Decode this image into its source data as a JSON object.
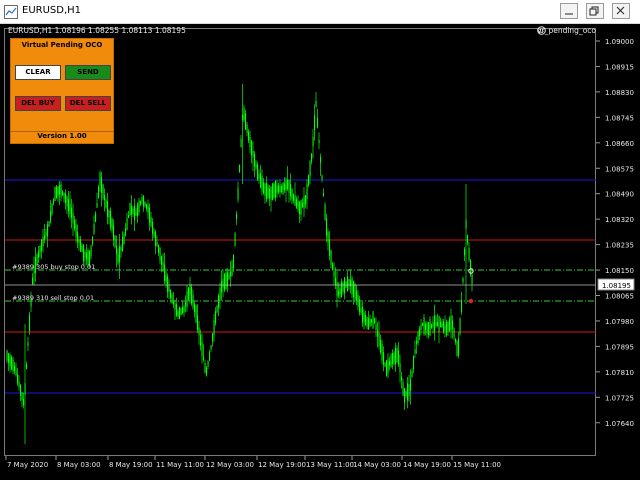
{
  "window": {
    "title": "EURUSD,H1",
    "controls": [
      "minimize-button",
      "restore-button",
      "close-button"
    ]
  },
  "chart": {
    "symbol_line": "EURUSD,H1  1.08196  1.08255  1.08113  1.08195",
    "indicator_name": "vr_pending_oco",
    "current_price": "1.08195",
    "price_labels": [
      "1.09000",
      "1.08915",
      "1.08830",
      "1.08745",
      "1.08660",
      "1.08575",
      "1.08490",
      "1.08320",
      "1.08235",
      "1.08150",
      "1.08065",
      "1.07980",
      "1.07895",
      "1.07810",
      "1.07725",
      "1.07640"
    ],
    "time_labels": [
      "7 May 2020",
      "8 May 03:00",
      "8 May 19:00",
      "11 May 11:00",
      "12 May 03:00",
      "12 May 19:00",
      "13 May 11:00",
      "14 May 03:00",
      "14 May 19:00",
      "15 May 11:00"
    ],
    "order_labels": {
      "buy_stop": "#9389 305 buy stop 0.01",
      "sell_stop": "#9389 310 sell stop 0.01"
    },
    "colors": {
      "background": "#000000",
      "candles": "#00ff00",
      "blue_level": "#1a1ae0",
      "red_level": "#d01818",
      "order_line": "#33cc33",
      "axis_text": "#e8e8e8"
    }
  },
  "panel": {
    "title": "Virtual Pending OCO",
    "clear_label": "CLEAR",
    "send_label": "SEND",
    "del_buy_label": "DEL BUY",
    "del_sell_label": "DEL SELL",
    "version": "Version 1.00",
    "colors": {
      "background": "#f08b0c",
      "clear": "#ffffff",
      "send": "#1a8a1a",
      "delete": "#c82020"
    }
  }
}
